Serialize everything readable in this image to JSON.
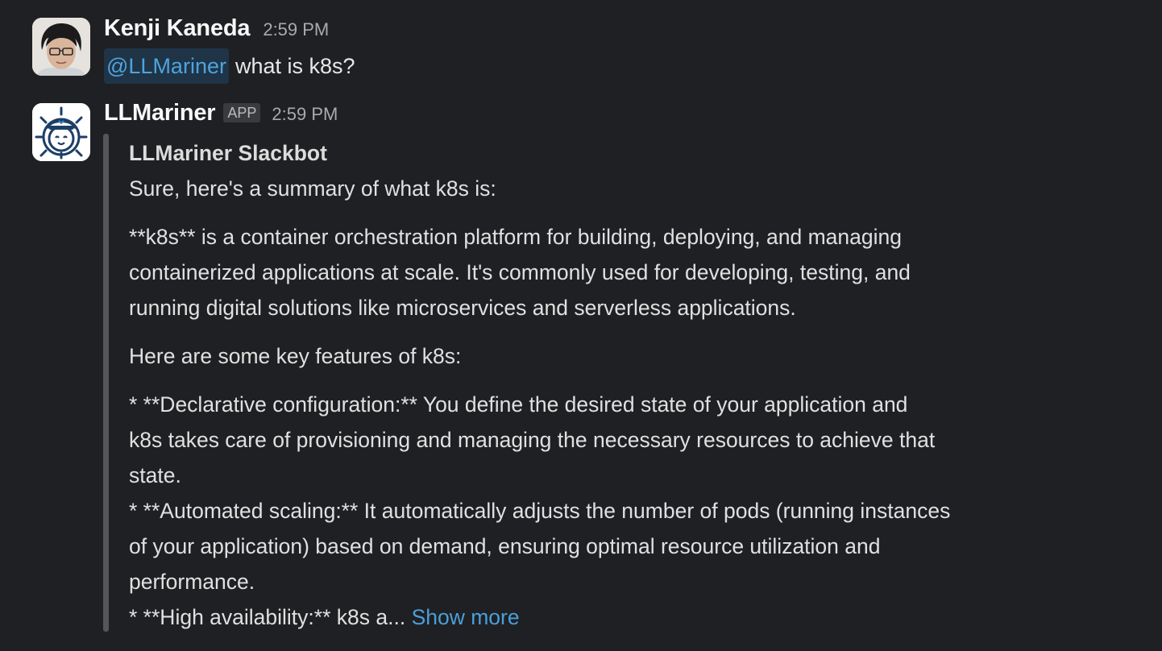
{
  "messages": [
    {
      "sender": "Kenji Kaneda",
      "time": "2:59 PM",
      "mention": "@LLMariner",
      "text": "what is k8s?"
    },
    {
      "sender": "LLMariner",
      "badge": "APP",
      "time": "2:59 PM",
      "attachment": {
        "title": "LLMariner Slackbot",
        "intro": "Sure, here's a summary of what k8s is:",
        "para1_line1": "**k8s** is a container orchestration platform for building, deploying, and managing",
        "para1_line2": "containerized applications at scale. It's commonly used for developing, testing, and",
        "para1_line3": "running digital solutions like microservices and serverless applications.",
        "features_heading": "Here are some key features of k8s:",
        "f1_line1": "* **Declarative configuration:** You define the desired state of your application and",
        "f1_line2": "k8s takes care of provisioning and managing the necessary resources to achieve that",
        "f1_line3": "state.",
        "f2_line1": "* **Automated scaling:** It automatically adjusts the number of pods (running instances",
        "f2_line2": "of your application) based on demand, ensuring optimal resource utilization and",
        "f2_line3": "performance.",
        "f3_truncated": "* **High availability:** k8s a...",
        "show_more": "Show more"
      }
    }
  ],
  "colors": {
    "background": "#1f2023",
    "link": "#4b9fd9",
    "mention_bg": "#1f3447",
    "quote_bar": "#54565a"
  },
  "icons": [
    "user-avatar-photo",
    "ship-wheel-sailor-bot-icon"
  ]
}
